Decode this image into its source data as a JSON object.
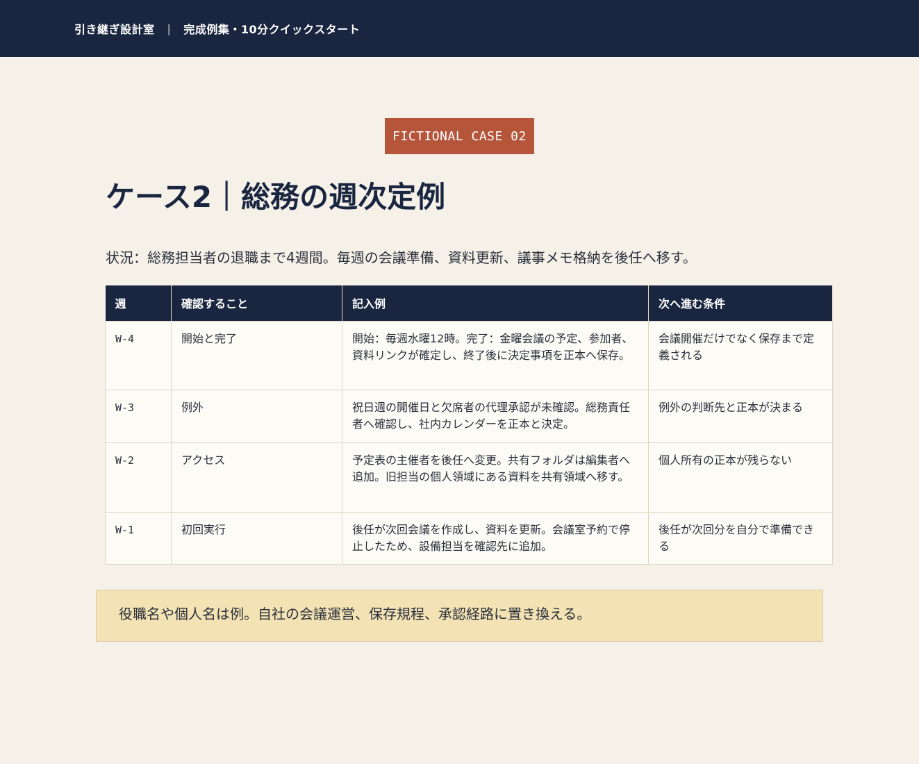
{
  "header": {
    "site_name": "引き継ぎ設計室",
    "separator": "|",
    "section": "完成例集・10分クイックスタート"
  },
  "badge": {
    "label": "FICTIONAL CASE 02"
  },
  "page_title": "ケース2｜総務の週次定例",
  "situation": "状況：総務担当者の退職まで4週間。毎週の会議準備、資料更新、議事メモ格納を後任へ移す。",
  "table": {
    "headers": [
      "週",
      "確認すること",
      "記入例",
      "次へ進む条件"
    ],
    "rows": [
      {
        "week": "W-4",
        "check": "開始と完了",
        "example": "開始：毎週水曜12時。完了：金曜会議の予定、参加者、資料リンクが確定し、終了後に決定事項を正本へ保存。",
        "condition": "会議開催だけでなく保存まで定義される"
      },
      {
        "week": "W-3",
        "check": "例外",
        "example": "祝日週の開催日と欠席者の代理承認が未確認。総務責任者へ確認し、社内カレンダーを正本と決定。",
        "condition": "例外の判断先と正本が決まる"
      },
      {
        "week": "W-2",
        "check": "アクセス",
        "example": "予定表の主催者を後任へ変更。共有フォルダは編集者へ追加。旧担当の個人領域にある資料を共有領域へ移す。",
        "condition": "個人所有の正本が残らない"
      },
      {
        "week": "W-1",
        "check": "初回実行",
        "example": "後任が次回会議を作成し、資料を更新。会議室予約で停止したため、設備担当を確認先に追加。",
        "condition": "後任が次回分を自分で準備できる"
      }
    ]
  },
  "note": "役職名や個人名は例。自社の会議運営、保存規程、承認経路に置き換える。"
}
